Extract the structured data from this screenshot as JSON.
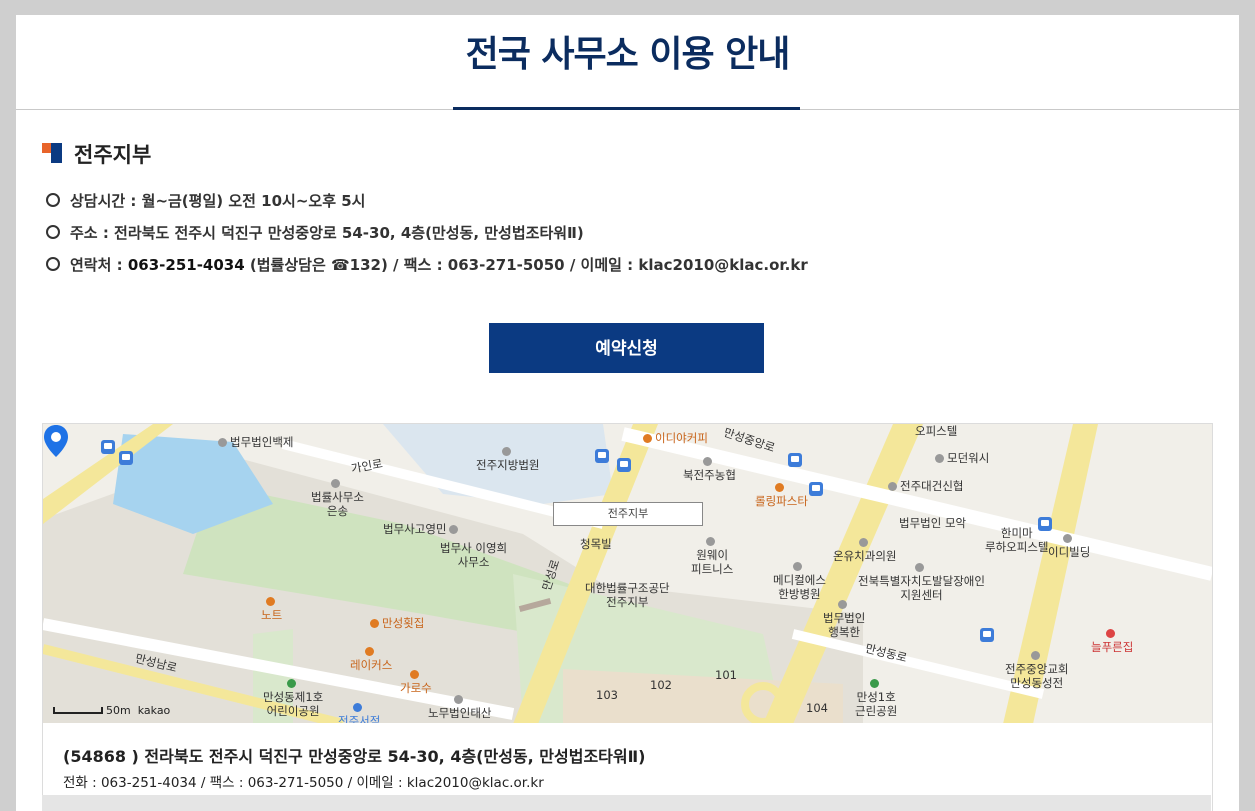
{
  "page": {
    "title": "전국 사무소 이용 안내"
  },
  "branch": {
    "name": "전주지부",
    "hours_label": "상담시간 : 월~금(평일) 오전 10시~오후 5시",
    "address_label": "주소 : 전라북도 전주시 덕진구 만성중앙로 54-30, 4층(만성동, 만성법조타워Ⅱ)",
    "contact_prefix": "연락처 : ",
    "contact_phone": "063-251-4034",
    "contact_rest": " (법률상담은 ☎132) / 팩스 : 063-271-5050 / 이메일 : klac2010@klac.or.kr"
  },
  "reserve_button": "예약신청",
  "map": {
    "callout": "전주지부",
    "scale": "50m",
    "brand": "kakao",
    "labels": {
      "p1": "법무법인백제",
      "p2": "전주지방법원",
      "p3": "이디야커피",
      "p4": "만성중앙로",
      "p5": "오피스텔",
      "p6": "모던워시",
      "p7": "북전주농협",
      "p8": "전주대건신협",
      "p9": "롤링파스타",
      "p10": "가인로",
      "p11": "법률사무소\n은송",
      "p12": "법무사고영민",
      "p13": "법무사 이영희\n사무소",
      "p14": "청목빌",
      "p15": "법무법인 모악",
      "p16": "한미마\n루하오피스텔",
      "p17": "이디빌딩",
      "p18": "원웨이\n피트니스",
      "p19": "온유치과의원",
      "p20": "대한법률구조공단\n전주지부",
      "p21": "메디컬에스\n한방병원",
      "p22": "전북특별자치도발달장애인\n지원센터",
      "p23": "노트",
      "p24": "만성횟집",
      "p25": "법무법인\n행복한",
      "p26": "만성동로",
      "p27": "늘푸른집",
      "p28": "만성남로",
      "p29": "레이커스",
      "p30": "가로수",
      "p31": "101",
      "p32": "102",
      "p33": "103",
      "p34": "104",
      "p35": "만성동제1호\n어린이공원",
      "p36": "노무법인태산",
      "p37": "전주중앙교회\n만성동성전",
      "p38": "만성1호\n근린공원",
      "p39": "전주서적",
      "p40": "만성로"
    }
  },
  "address_box": {
    "main": "(54868 ) 전라북도 전주시 덕진구 만성중앙로 54-30, 4층(만성동, 만성법조타워Ⅱ)",
    "sub": "전화 : 063-251-4034 / 팩스 : 063-271-5050 / 이메일 : klac2010@klac.or.kr"
  },
  "colors": {
    "navy": "#0b2c5f",
    "button": "#0b3a82",
    "accent_orange": "#e8642a"
  }
}
